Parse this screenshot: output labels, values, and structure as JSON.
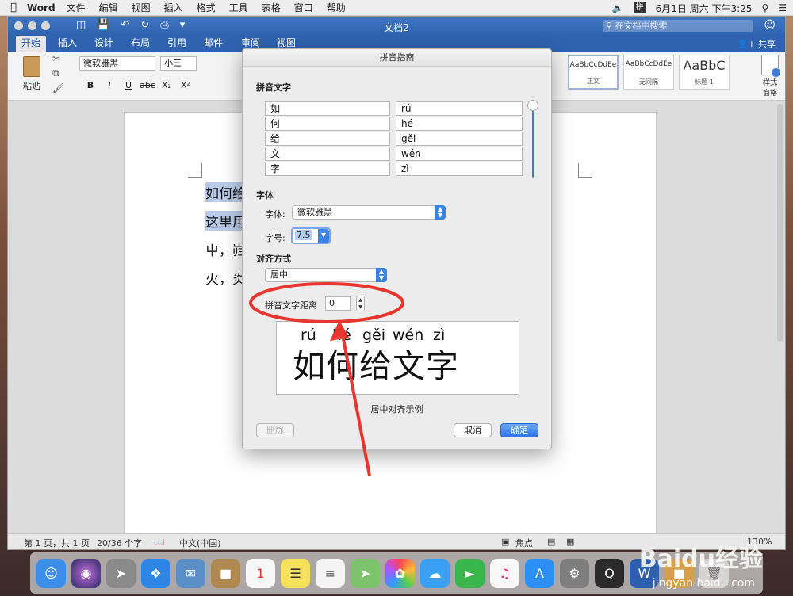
{
  "menubar": {
    "app": "Word",
    "items": [
      "文件",
      "编辑",
      "视图",
      "插入",
      "格式",
      "工具",
      "表格",
      "窗口",
      "帮助"
    ],
    "ime": "拼",
    "clock": "6月1日 周六 下午3:25"
  },
  "window": {
    "title": "文档2",
    "search_placeholder": "在文档中搜索",
    "share": "共享",
    "tabs": [
      "开始",
      "插入",
      "设计",
      "布局",
      "引用",
      "邮件",
      "审阅",
      "视图"
    ]
  },
  "ribbon": {
    "paste": "粘贴",
    "font_name": "微软雅黑",
    "font_size": "小三",
    "format_buttons": [
      "B",
      "I",
      "U",
      "abc",
      "X₂",
      "X²"
    ],
    "styles": [
      {
        "sample": "AaBbCcDdEe",
        "name": "正文"
      },
      {
        "sample": "AaBbCcDdEe",
        "name": "无间隔"
      },
      {
        "sample": "AaBbC",
        "name": "标题 1"
      }
    ],
    "styles_pane": "样式\n窗格"
  },
  "document": {
    "lines": [
      "如何给",
      "这里用",
      "屮，岿",
      "火，炎"
    ]
  },
  "statusbar": {
    "page": "第 1 页，共 1 页",
    "words": "20/36 个字",
    "language": "中文(中国)",
    "focus": "焦点",
    "zoom": "130%"
  },
  "dialog": {
    "title": "拼音指南",
    "section_text": "拼音文字",
    "base_text": [
      "如",
      "何",
      "给",
      "文",
      "字"
    ],
    "ruby_text": [
      "rú",
      "hé",
      "gěi",
      "wén",
      "zì"
    ],
    "section_font": "字体",
    "font_label": "字体:",
    "font_value": "微软雅黑",
    "size_label": "字号:",
    "size_value": "7.5",
    "section_align": "对齐方式",
    "align_value": "居中",
    "offset_label": "拼音文字距离",
    "offset_value": "0",
    "preview_pinyin": [
      "rú",
      "hé",
      "gěi",
      "wén",
      "zì"
    ],
    "preview_text": "如何给文字",
    "caption": "居中对齐示例",
    "delete_button": "删除",
    "cancel_button": "取消",
    "ok_button": "确定"
  },
  "watermark": {
    "brand": "Baidu经验",
    "url": "jingyan.baidu.com"
  },
  "colors": {
    "word_blue": "#2f63b0",
    "accent_blue": "#3b82e5",
    "annotation_red": "#e8362f"
  }
}
